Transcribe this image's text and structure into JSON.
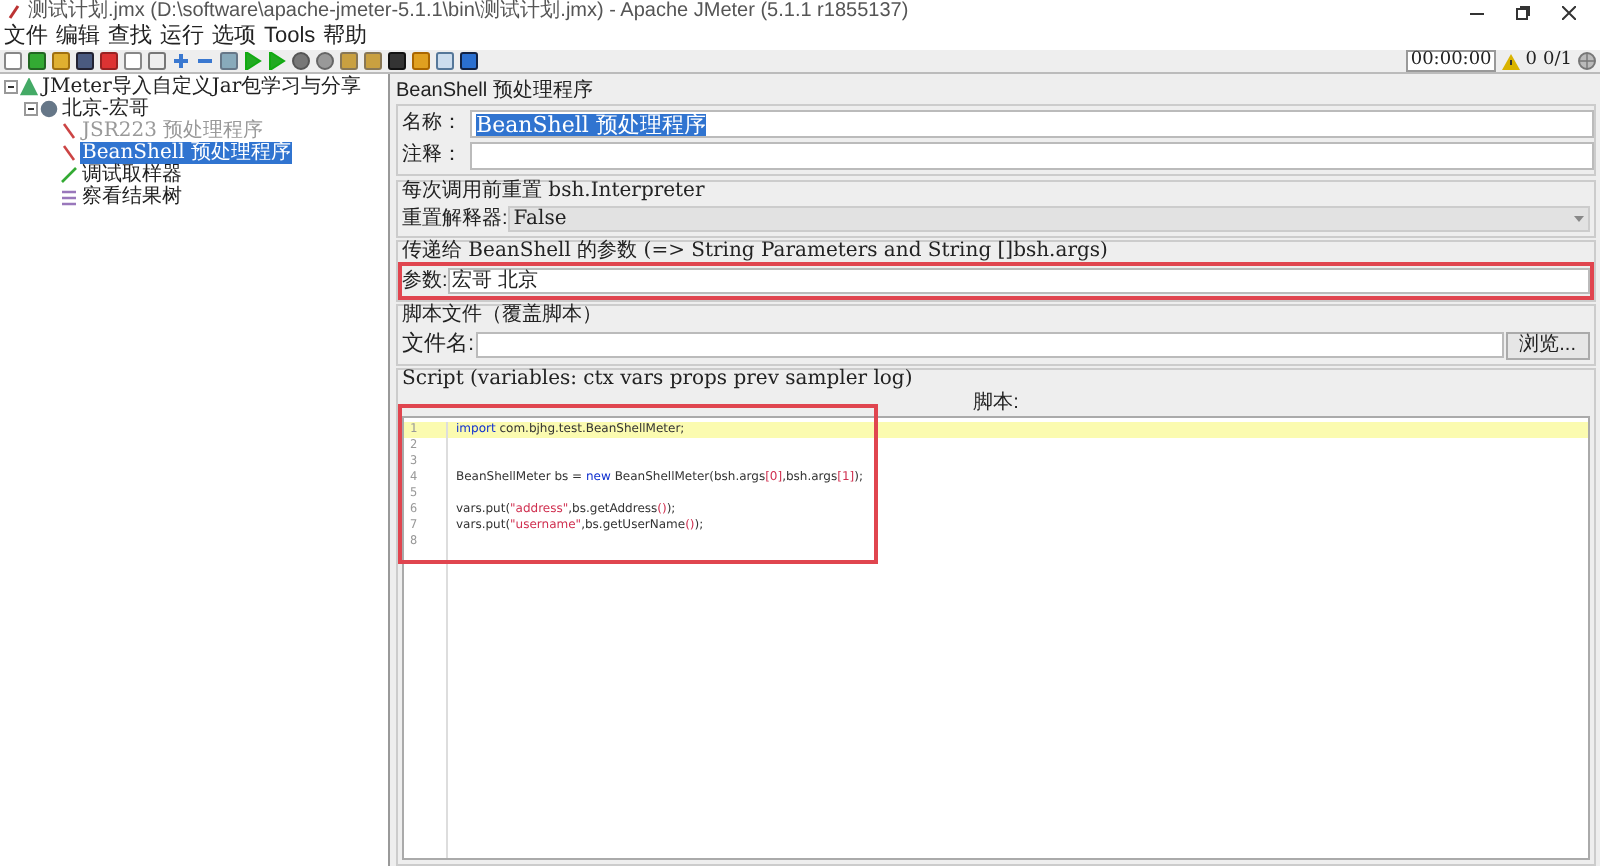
{
  "window": {
    "title": "测试计划.jmx (D:\\software\\apache-jmeter-5.1.1\\bin\\测试计划.jmx) - Apache JMeter (5.1.1 r1855137)"
  },
  "menu": [
    "文件",
    "编辑",
    "查找",
    "运行",
    "选项",
    "Tools",
    "帮助"
  ],
  "status": {
    "timer": "00:00:00",
    "warnings": "0",
    "threads": "0/1"
  },
  "tree": [
    {
      "label": "JMeter导入自定义Jar包学习与分享",
      "kind": "plan",
      "selected": false,
      "disabled": false,
      "expanded": true,
      "children": [
        {
          "label": "北京-宏哥",
          "kind": "group",
          "selected": false,
          "disabled": false,
          "expanded": true,
          "children": [
            {
              "label": "JSR223 预处理程序",
              "kind": "pre",
              "selected": false,
              "disabled": true
            },
            {
              "label": "BeanShell 预处理程序",
              "kind": "pre",
              "selected": true,
              "disabled": false
            },
            {
              "label": "调试取样器",
              "kind": "sampler",
              "selected": false,
              "disabled": false
            },
            {
              "label": "察看结果树",
              "kind": "listener",
              "selected": false,
              "disabled": false
            }
          ]
        }
      ]
    }
  ],
  "panel": {
    "title": "BeanShell 预处理程序",
    "name": {
      "label": "名称：",
      "value": "BeanShell 预处理程序"
    },
    "comment": {
      "label": "注释："
    },
    "reset_group": {
      "title": "每次调用前重置 bsh.Interpreter",
      "label": "重置解释器:",
      "value": "False"
    },
    "params_group": {
      "title": "传递给 BeanShell 的参数 (=> String Parameters and String []bsh.args)",
      "label": "参数:",
      "value": "宏哥 北京",
      "highlighted": true
    },
    "file_group": {
      "title": "脚本文件（覆盖脚本）",
      "label": "文件名:",
      "button": "浏览..."
    },
    "script_group": {
      "title": "Script (variables: ctx vars props prev sampler log)",
      "label": "脚本:",
      "highlighted": true,
      "lines": [
        {
          "number": "1",
          "current": true,
          "tokens": [
            {
              "kind": "keyword",
              "text": "import"
            },
            {
              "kind": "plain",
              "text": " com.bjhg.test.BeanShellMeter;"
            }
          ]
        },
        {
          "number": "2",
          "current": false
        },
        {
          "number": "3",
          "current": false
        },
        {
          "number": "4",
          "current": false,
          "tokens": [
            {
              "kind": "plain",
              "text": "BeanShellMeter bs = "
            },
            {
              "kind": "keyword",
              "text": "new"
            },
            {
              "kind": "plain",
              "text": " BeanShellMeter(bsh.args"
            },
            {
              "kind": "bracket",
              "text": "[0]"
            },
            {
              "kind": "plain",
              "text": ",bsh.args"
            },
            {
              "kind": "bracket",
              "text": "[1]"
            },
            {
              "kind": "plain",
              "text": ");"
            }
          ]
        },
        {
          "number": "5",
          "current": false
        },
        {
          "number": "6",
          "current": false,
          "tokens": [
            {
              "kind": "plain",
              "text": "vars.put("
            },
            {
              "kind": "string",
              "text": "\"address\""
            },
            {
              "kind": "plain",
              "text": ",bs.getAddress"
            },
            {
              "kind": "bracket",
              "text": "()"
            },
            {
              "kind": "plain",
              "text": ");"
            }
          ]
        },
        {
          "number": "7",
          "current": false,
          "tokens": [
            {
              "kind": "plain",
              "text": "vars.put("
            },
            {
              "kind": "string",
              "text": "\"username\""
            },
            {
              "kind": "plain",
              "text": ",bs.getUserName"
            },
            {
              "kind": "bracket",
              "text": "()"
            },
            {
              "kind": "plain",
              "text": ");"
            }
          ]
        },
        {
          "number": "8",
          "current": false
        }
      ]
    }
  }
}
